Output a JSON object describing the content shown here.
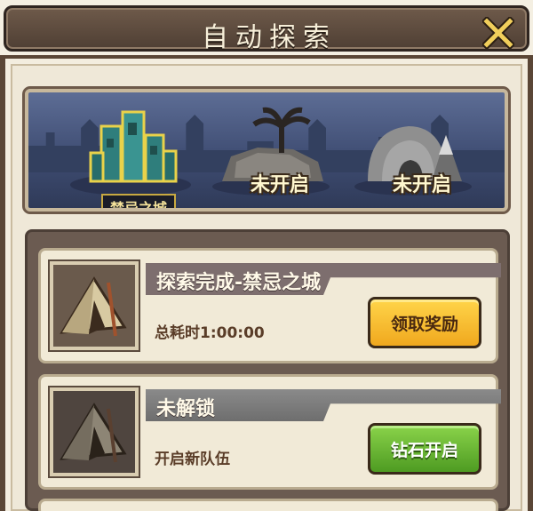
{
  "header": {
    "title": "自动探索",
    "close_icon": "close-x-icon"
  },
  "map": {
    "slots": [
      {
        "label": "禁忌之城",
        "state": "active",
        "icon": "ruined-city-icon"
      },
      {
        "label": "未开启",
        "state": "locked",
        "icon": "palm-island-icon"
      },
      {
        "label": "未开启",
        "state": "locked",
        "icon": "snow-igloo-icon"
      }
    ]
  },
  "cards": [
    {
      "title": "探索完成-禁忌之城",
      "subtitle": "总耗时1:00:00",
      "button": "领取奖励",
      "button_color": "#f0a81e",
      "icon": "tent-icon"
    },
    {
      "title": "未解锁",
      "subtitle": "开启新队伍",
      "button": "钻石开启",
      "button_color": "#4e9b22",
      "icon": "tent-icon"
    }
  ],
  "colors": {
    "frame": "#5a4636",
    "parchment": "#f1ead7",
    "map_bg": "#3f4d73",
    "gold": "#f0a81e",
    "green": "#4e9b22"
  }
}
